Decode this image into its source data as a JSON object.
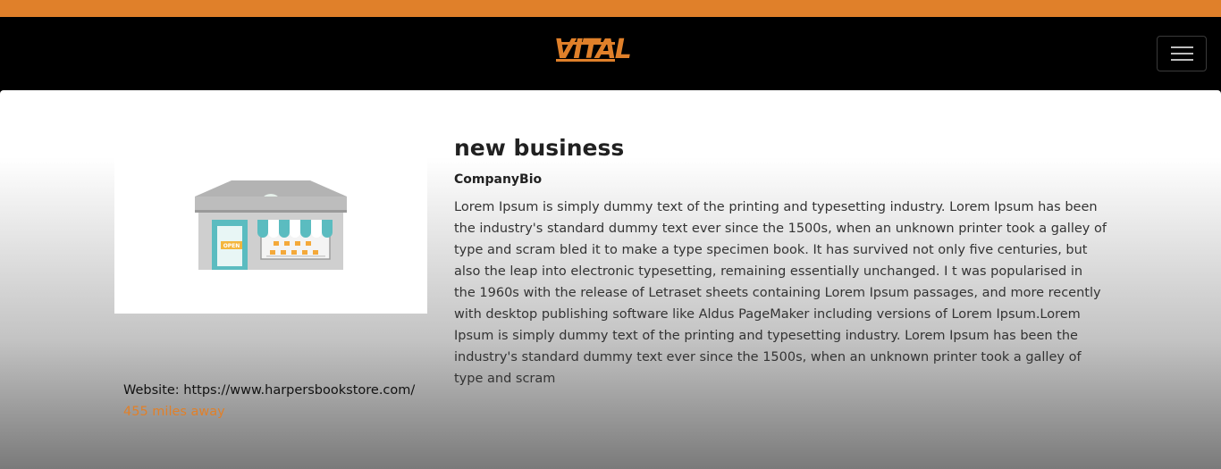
{
  "brand": {
    "logo_text": "VITAL",
    "accent_color": "#e0802a"
  },
  "navbar": {
    "menu_icon": "hamburger-menu-icon"
  },
  "business": {
    "image_icon": "storefront-icon",
    "sign_text": "OPEN",
    "title": "new business",
    "bio_label": "CompanyBio",
    "bio": "Lorem Ipsum is simply dummy text of the printing and typesetting industry. Lorem Ipsum has been the industry's standard dummy text ever since the 1500s, when an unknown printer took a galley of type and scram bled it to make a type specimen book. It has survived not only five centuries, but also the leap into electronic typesetting, remaining essentially unchanged. I t was popularised in the 1960s with the release of Letraset sheets containing Lorem Ipsum passages, and more recently with desktop publishing software like Aldus PageMaker including versions of Lorem Ipsum.Lorem Ipsum is simply dummy text of the printing and typesetting industry. Lorem Ipsum has been the industry's standard dummy text ever since the 1500s, when an unknown printer took a galley of type and scram",
    "website": "Website: https://www.harpersbookstore.com/",
    "distance": "455 miles away"
  }
}
